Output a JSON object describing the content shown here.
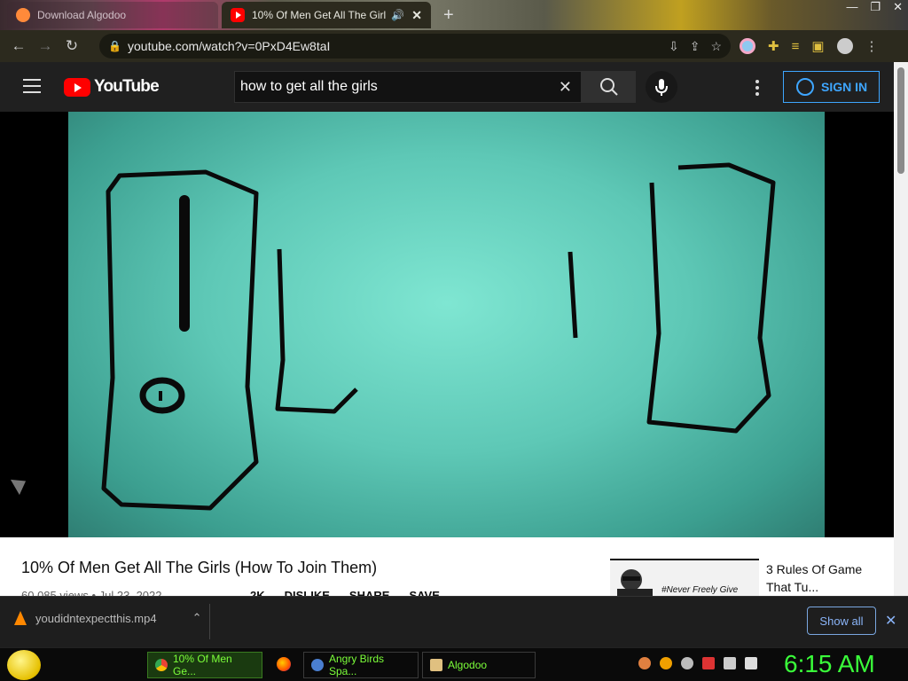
{
  "browser": {
    "tabs": [
      {
        "label": "Download Algodoo",
        "active": false
      },
      {
        "label": "10% Of Men Get All The Girl",
        "active": true
      }
    ],
    "new_tab": "+",
    "window_controls": [
      "—",
      "❐",
      "✕"
    ],
    "url": "youtube.com/watch?v=0PxD4Ew8taI"
  },
  "youtube": {
    "logo_text": "YouTube",
    "search_value": "how to get all the girls",
    "sign_in_label": "SIGN IN"
  },
  "video": {
    "title": "10% Of Men Get All The Girls (How To Join Them)",
    "meta": "60,085 views • Jul 23, 2022",
    "actions": [
      "2K",
      "DISLIKE",
      "SHARE",
      "SAVE"
    ]
  },
  "recommended": [
    {
      "title": "3 Rules Of Game That Tu...",
      "thumb_caption": "#Never Freely Give"
    }
  ],
  "downloads": {
    "file": "youdidntexpectthis.mp4",
    "show_all": "Show all"
  },
  "taskbar": {
    "buttons": [
      {
        "label": "10% Of Men Ge...",
        "active": true
      },
      {
        "label": "Angry Birds Spa...",
        "active": false
      },
      {
        "label": "Algodoo",
        "active": false
      }
    ],
    "clock": "6:15 AM"
  },
  "colors": {
    "youtube_red": "#ff0000",
    "signin_blue": "#3ea6ff",
    "clock_green": "#3aff3a",
    "taskbar_text": "#7cff3a",
    "video_teal": "#5ec8b6"
  }
}
